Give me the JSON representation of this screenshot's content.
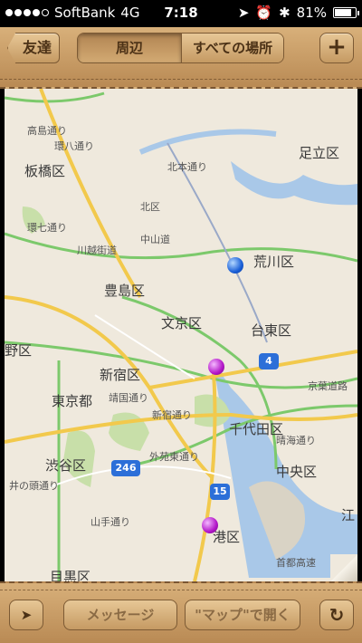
{
  "status_bar": {
    "carrier": "SoftBank",
    "network": "4G",
    "time": "7:18",
    "battery": "81%",
    "battery_level": 0.81,
    "signal_bars": 4
  },
  "top_bar": {
    "back_label": "友達",
    "segments": [
      "周辺",
      "すべての場所"
    ],
    "selected_segment": "周辺",
    "add_label": "+"
  },
  "map": {
    "wards": [
      {
        "name": "足立区"
      },
      {
        "name": "板橋区"
      },
      {
        "name": "北区"
      },
      {
        "name": "荒川区"
      },
      {
        "name": "豊島区"
      },
      {
        "name": "文京区"
      },
      {
        "name": "台東区"
      },
      {
        "name": "野区"
      },
      {
        "name": "新宿区"
      },
      {
        "name": "東京都"
      },
      {
        "name": "千代田区"
      },
      {
        "name": "渋谷区"
      },
      {
        "name": "中央区"
      },
      {
        "name": "港区"
      },
      {
        "name": "目黒区"
      },
      {
        "name": "江"
      }
    ],
    "roads": [
      "高島通り",
      "環八通り",
      "中山道",
      "川越街道",
      "環七通り",
      "北本通り",
      "京葉道路",
      "靖国通り",
      "新宿通り",
      "外苑東通り",
      "晴海通り",
      "井の頭通り",
      "山手通り",
      "首都高速"
    ],
    "route_shields": [
      "4",
      "246",
      "15"
    ],
    "colors": {
      "road_major": "#f2c94c",
      "road_minor": "#ffffff",
      "expressway": "#7cc96b",
      "water": "#a9c8e8",
      "park": "#c8dfa9",
      "pin_blue": "#1a5fd7",
      "pin_purple": "#b316c9"
    }
  },
  "bottom_bar": {
    "location_icon": "location-arrow-icon",
    "message_label": "メッセージ",
    "open_maps_label": "\"マップ\"で開く",
    "refresh_icon": "refresh-icon"
  }
}
